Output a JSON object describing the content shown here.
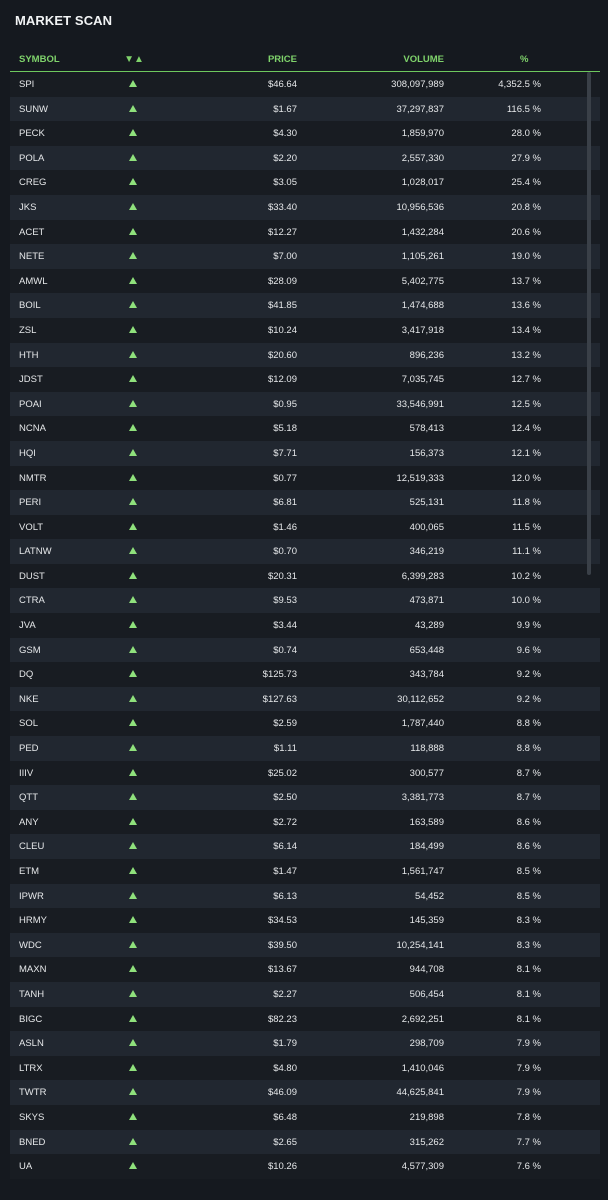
{
  "title": "MARKET SCAN",
  "colors": {
    "accent": "#7fd36b",
    "background": "#15191f"
  },
  "headers": {
    "symbol": "SYMBOL",
    "sort": "▼▲",
    "price": "PRICE",
    "volume": "VOLUME",
    "pct": "%"
  },
  "rows": [
    {
      "symbol": "SPI",
      "price": "$46.64",
      "volume": "308,097,989",
      "pct": "4,352.5 %"
    },
    {
      "symbol": "SUNW",
      "price": "$1.67",
      "volume": "37,297,837",
      "pct": "116.5 %"
    },
    {
      "symbol": "PECK",
      "price": "$4.30",
      "volume": "1,859,970",
      "pct": "28.0 %"
    },
    {
      "symbol": "POLA",
      "price": "$2.20",
      "volume": "2,557,330",
      "pct": "27.9 %"
    },
    {
      "symbol": "CREG",
      "price": "$3.05",
      "volume": "1,028,017",
      "pct": "25.4 %"
    },
    {
      "symbol": "JKS",
      "price": "$33.40",
      "volume": "10,956,536",
      "pct": "20.8 %"
    },
    {
      "symbol": "ACET",
      "price": "$12.27",
      "volume": "1,432,284",
      "pct": "20.6 %"
    },
    {
      "symbol": "NETE",
      "price": "$7.00",
      "volume": "1,105,261",
      "pct": "19.0 %"
    },
    {
      "symbol": "AMWL",
      "price": "$28.09",
      "volume": "5,402,775",
      "pct": "13.7 %"
    },
    {
      "symbol": "BOIL",
      "price": "$41.85",
      "volume": "1,474,688",
      "pct": "13.6 %"
    },
    {
      "symbol": "ZSL",
      "price": "$10.24",
      "volume": "3,417,918",
      "pct": "13.4 %"
    },
    {
      "symbol": "HTH",
      "price": "$20.60",
      "volume": "896,236",
      "pct": "13.2 %"
    },
    {
      "symbol": "JDST",
      "price": "$12.09",
      "volume": "7,035,745",
      "pct": "12.7 %"
    },
    {
      "symbol": "POAI",
      "price": "$0.95",
      "volume": "33,546,991",
      "pct": "12.5 %"
    },
    {
      "symbol": "NCNA",
      "price": "$5.18",
      "volume": "578,413",
      "pct": "12.4 %"
    },
    {
      "symbol": "HQI",
      "price": "$7.71",
      "volume": "156,373",
      "pct": "12.1 %"
    },
    {
      "symbol": "NMTR",
      "price": "$0.77",
      "volume": "12,519,333",
      "pct": "12.0 %"
    },
    {
      "symbol": "PERI",
      "price": "$6.81",
      "volume": "525,131",
      "pct": "11.8 %"
    },
    {
      "symbol": "VOLT",
      "price": "$1.46",
      "volume": "400,065",
      "pct": "11.5 %"
    },
    {
      "symbol": "LATNW",
      "price": "$0.70",
      "volume": "346,219",
      "pct": "11.1 %"
    },
    {
      "symbol": "DUST",
      "price": "$20.31",
      "volume": "6,399,283",
      "pct": "10.2 %"
    },
    {
      "symbol": "CTRA",
      "price": "$9.53",
      "volume": "473,871",
      "pct": "10.0 %"
    },
    {
      "symbol": "JVA",
      "price": "$3.44",
      "volume": "43,289",
      "pct": "9.9 %"
    },
    {
      "symbol": "GSM",
      "price": "$0.74",
      "volume": "653,448",
      "pct": "9.6 %"
    },
    {
      "symbol": "DQ",
      "price": "$125.73",
      "volume": "343,784",
      "pct": "9.2 %"
    },
    {
      "symbol": "NKE",
      "price": "$127.63",
      "volume": "30,112,652",
      "pct": "9.2 %"
    },
    {
      "symbol": "SOL",
      "price": "$2.59",
      "volume": "1,787,440",
      "pct": "8.8 %"
    },
    {
      "symbol": "PED",
      "price": "$1.11",
      "volume": "118,888",
      "pct": "8.8 %"
    },
    {
      "symbol": "IIIV",
      "price": "$25.02",
      "volume": "300,577",
      "pct": "8.7 %"
    },
    {
      "symbol": "QTT",
      "price": "$2.50",
      "volume": "3,381,773",
      "pct": "8.7 %"
    },
    {
      "symbol": "ANY",
      "price": "$2.72",
      "volume": "163,589",
      "pct": "8.6 %"
    },
    {
      "symbol": "CLEU",
      "price": "$6.14",
      "volume": "184,499",
      "pct": "8.6 %"
    },
    {
      "symbol": "ETM",
      "price": "$1.47",
      "volume": "1,561,747",
      "pct": "8.5 %"
    },
    {
      "symbol": "IPWR",
      "price": "$6.13",
      "volume": "54,452",
      "pct": "8.5 %"
    },
    {
      "symbol": "HRMY",
      "price": "$34.53",
      "volume": "145,359",
      "pct": "8.3 %"
    },
    {
      "symbol": "WDC",
      "price": "$39.50",
      "volume": "10,254,141",
      "pct": "8.3 %"
    },
    {
      "symbol": "MAXN",
      "price": "$13.67",
      "volume": "944,708",
      "pct": "8.1 %"
    },
    {
      "symbol": "TANH",
      "price": "$2.27",
      "volume": "506,454",
      "pct": "8.1 %"
    },
    {
      "symbol": "BIGC",
      "price": "$82.23",
      "volume": "2,692,251",
      "pct": "8.1 %"
    },
    {
      "symbol": "ASLN",
      "price": "$1.79",
      "volume": "298,709",
      "pct": "7.9 %"
    },
    {
      "symbol": "LTRX",
      "price": "$4.80",
      "volume": "1,410,046",
      "pct": "7.9 %"
    },
    {
      "symbol": "TWTR",
      "price": "$46.09",
      "volume": "44,625,841",
      "pct": "7.9 %"
    },
    {
      "symbol": "SKYS",
      "price": "$6.48",
      "volume": "219,898",
      "pct": "7.8 %"
    },
    {
      "symbol": "BNED",
      "price": "$2.65",
      "volume": "315,262",
      "pct": "7.7 %"
    },
    {
      "symbol": "UA",
      "price": "$10.26",
      "volume": "4,577,309",
      "pct": "7.6 %"
    }
  ]
}
